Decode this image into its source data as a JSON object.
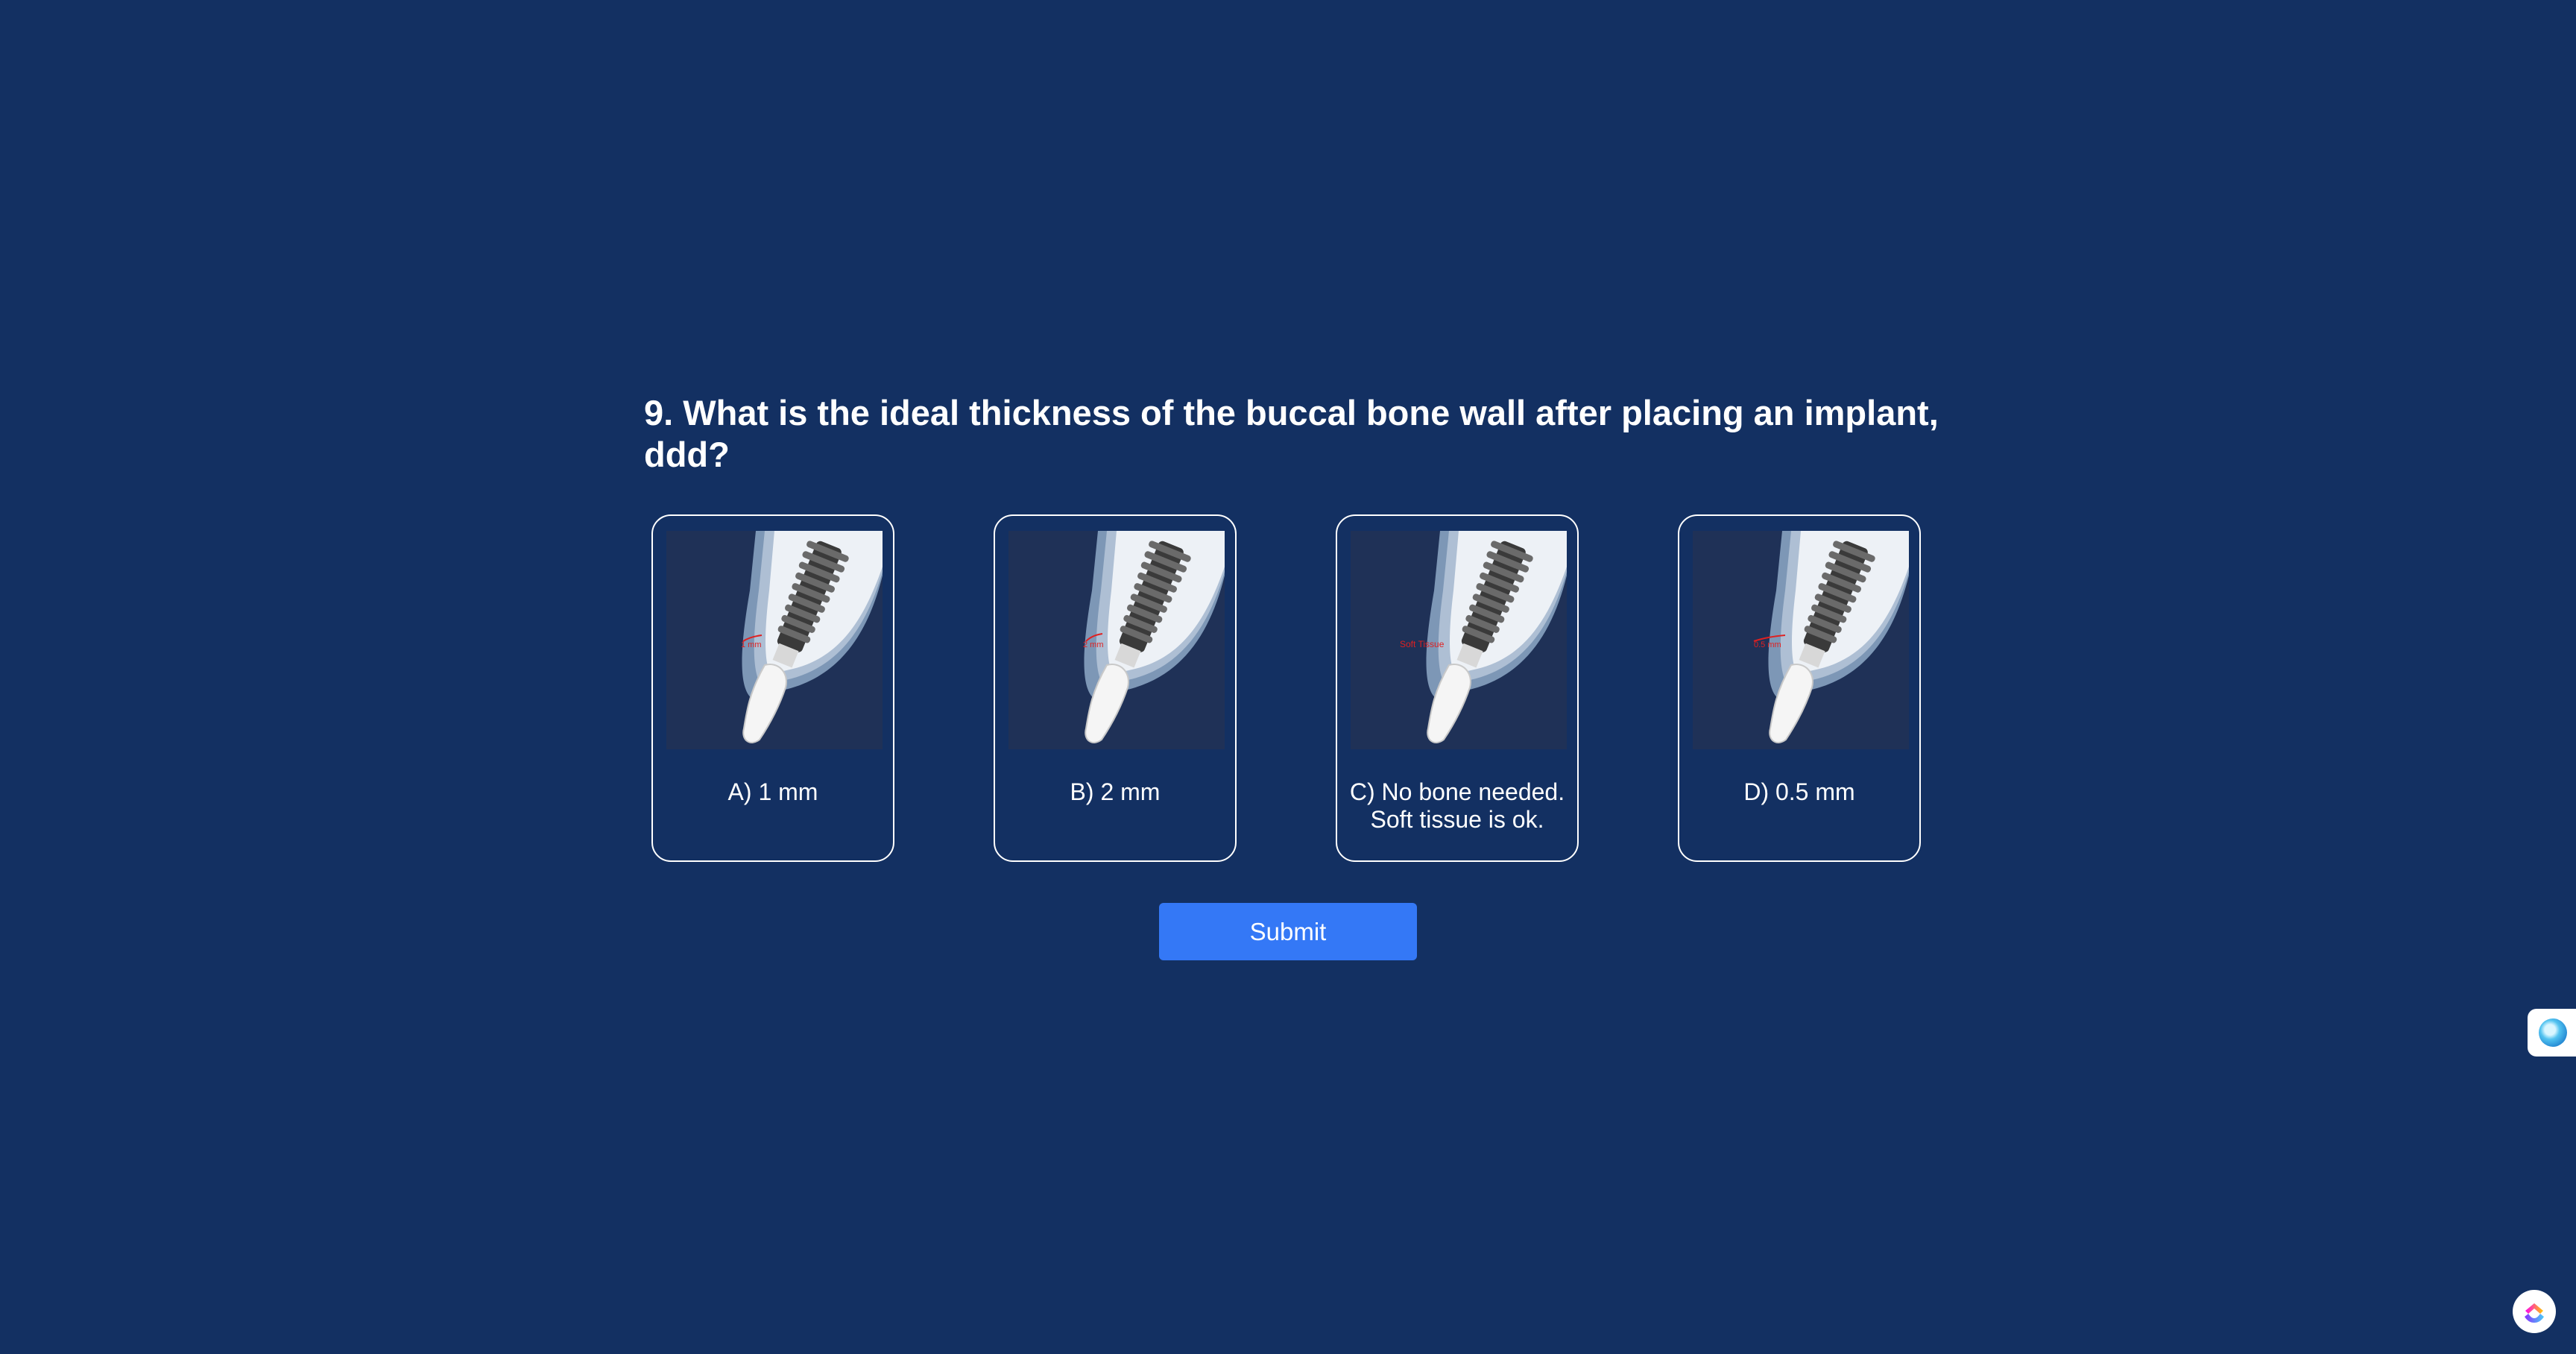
{
  "question": {
    "text": "9. What is the ideal thickness of the buccal bone wall after placing an implant, ddd?"
  },
  "options": [
    {
      "label": "A) 1 mm",
      "image_caption": "1 mm"
    },
    {
      "label": "B) 2 mm",
      "image_caption": "2 mm"
    },
    {
      "label": "C) No bone needed.\nSoft tissue is ok.",
      "image_caption": "Soft Tissue"
    },
    {
      "label": "D) 0.5 mm",
      "image_caption": "0.5 mm"
    }
  ],
  "submit": {
    "label": "Submit"
  },
  "colors": {
    "background": "#133062",
    "card_image_background": "#1f3157",
    "submit_button": "#3478f6",
    "annotation_red": "#e02020"
  },
  "icons": {
    "side_widget": "assistant-orb-icon",
    "corner_widget": "clickup-logo-icon"
  }
}
